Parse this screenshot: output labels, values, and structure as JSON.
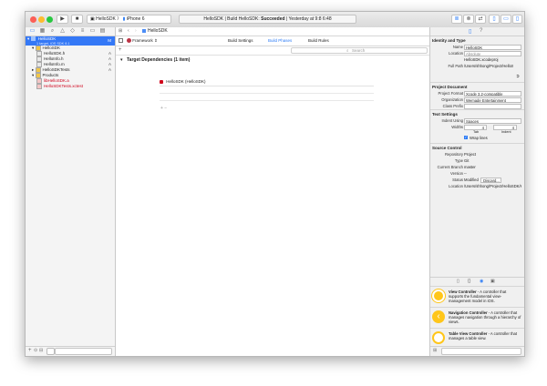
{
  "toolbar": {
    "scheme": "HelloSDK",
    "destination": "iPhone 6",
    "status_project": "HelloSDK",
    "status_build": "Build HelloSDK:",
    "status_result": "Succeeded",
    "status_time": "Yesterday at 9:8 6:48"
  },
  "navigator": {
    "tabs": [
      "▭",
      "▦",
      "⌕",
      "△",
      "◇",
      "≡",
      "▭",
      "▤"
    ],
    "project_name": "HelloSDK",
    "project_subtitle": "1 target, iOS SDK 8.1",
    "rows": [
      {
        "label": "HelloSDK",
        "indent": 1,
        "kind": "folder",
        "badge": ""
      },
      {
        "label": "HelloSDK.h",
        "indent": 2,
        "kind": "h",
        "badge": "A"
      },
      {
        "label": "HelloInfo.h",
        "indent": 2,
        "kind": "h",
        "badge": "A"
      },
      {
        "label": "HelloInfo.m",
        "indent": 2,
        "kind": "m",
        "badge": "A"
      },
      {
        "label": "HelloSDKTests",
        "indent": 1,
        "kind": "folder",
        "badge": "A"
      },
      {
        "label": "Products",
        "indent": 1,
        "kind": "folder",
        "badge": ""
      },
      {
        "label": "libHelloSDK.a",
        "indent": 2,
        "kind": "product",
        "badge": ""
      },
      {
        "label": "HelloSDKTests.xctest",
        "indent": 2,
        "kind": "product",
        "badge": ""
      }
    ],
    "filter_icons": [
      "+",
      "⊙",
      "⊟"
    ]
  },
  "editor": {
    "breadcrumb": "HelloSDK",
    "target": "Framework",
    "tabs": [
      "Build Settings",
      "Build Phases",
      "Build Rules"
    ],
    "active_tab": "Build Phases",
    "search_placeholder": "Search",
    "phase_title": "Target Dependencies (1 item)",
    "dependency": "HelloSDK (HelloSDK)",
    "add_remove": "+  −"
  },
  "inspector": {
    "identity_title": "Identity and Type",
    "name_label": "Name",
    "name_value": "HelloSDK",
    "location_label": "Location",
    "location_value": "Absolute",
    "location_file": "HelloSDK.xcodeproj",
    "fullpath_label": "Full Path",
    "fullpath_value": "/Users/shhong/Project/HelloSDK/HelloSDK.xcodeproj",
    "projdoc_title": "Project Document",
    "format_label": "Project Format",
    "format_value": "Xcode 3.2-compatible",
    "org_label": "Organization",
    "org_value": "Wemade Entertainment",
    "prefix_label": "Class Prefix",
    "prefix_value": "",
    "text_title": "Text Settings",
    "indent_label": "Indent Using",
    "indent_value": "Spaces",
    "widths_label": "Widths",
    "tab_width": "4",
    "indent_width": "4",
    "tab_caption": "Tab",
    "indent_caption": "Indent",
    "wrap_label": "Wrap lines",
    "sc_title": "Source Control",
    "repo_label": "Repository",
    "repo_value": "Project",
    "type_label": "Type",
    "type_value": "Git",
    "branch_label": "Current Branch",
    "branch_value": "master",
    "version_label": "Version",
    "version_value": "--",
    "status_label": "Status",
    "status_value": "Modified",
    "discard_label": "Discard...",
    "sc_location_label": "Location",
    "sc_location_value": "/Users/shhong/Project/HelloSDK/HelloSDK.xcodeproj"
  },
  "library": {
    "items": [
      {
        "title": "View Controller",
        "desc": " - A controller that supports the fundamental view-management model in iOS."
      },
      {
        "title": "Navigation Controller",
        "desc": " - A controller that manages navigation through a hierarchy of views."
      },
      {
        "title": "Table View Controller",
        "desc": " - A controller that manages a table view."
      }
    ]
  },
  "colors": {
    "accent": "#2d7cf6",
    "selection": "#3478f6",
    "product_red": "#d0021b",
    "library_icon": "#ffc61a"
  }
}
